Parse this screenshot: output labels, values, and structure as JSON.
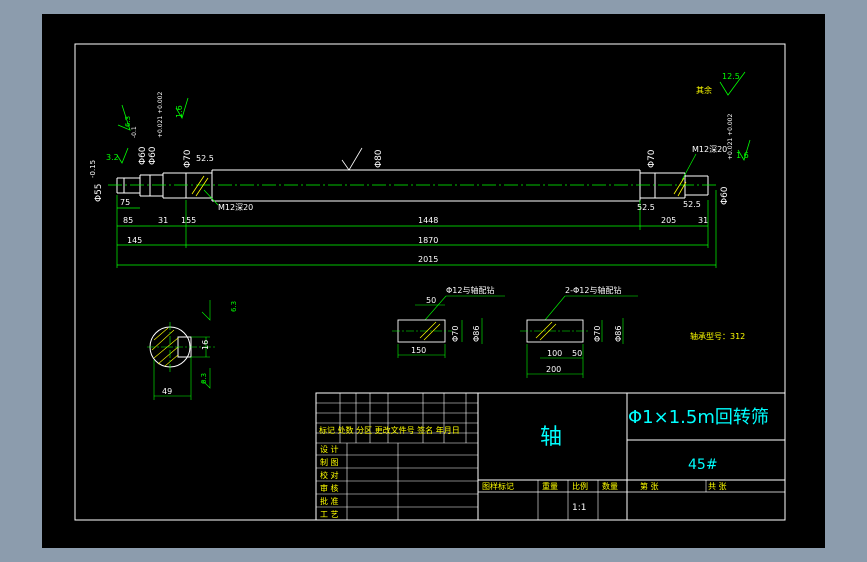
{
  "colors": {
    "outer_bg": "#8c9cad",
    "sheet_bg": "#000000",
    "line": "#ffffff",
    "dim": "#00ff00",
    "text": "#00ffff",
    "hatch": "#ffff00",
    "label": "#ffff00"
  },
  "roughness": {
    "general_label": "其余",
    "general_value": "12.5",
    "left_value": "1.6",
    "right_value": "1.6",
    "left_end_value": "3.2",
    "left_top_value": "6.3"
  },
  "shaft_dims": {
    "left_end_dia": "Φ55",
    "left_end_tol": "-0.15",
    "left_bearing_dia_1": "Φ60",
    "left_bearing_tol_1": "-0.1",
    "left_bearing_dia_2": "Φ60",
    "left_bearing_tol_2": "+0.021 +0.002",
    "left_shoulder_dia": "Φ70",
    "left_chamfer": "52.5",
    "body_dia": "Φ80",
    "right_shoulder_dia": "Φ70",
    "right_thread": "M12深20",
    "right_bearing_dia": "Φ60",
    "right_bearing_tol": "+0.021 +0.002",
    "left_thread": "M12深20",
    "l_75": "75",
    "l_85": "85",
    "l_31_left": "31",
    "l_155": "155",
    "l_1448": "1448",
    "l_525_right": "52.5",
    "l_525_right2": "52.5",
    "l_205": "205",
    "l_31_right": "31",
    "l_145": "145",
    "l_1870": "1870",
    "l_2015": "2015"
  },
  "keyway_left": {
    "title": "Φ12与轴配钻",
    "dim_50": "50",
    "dim_150": "150",
    "dia_70": "Φ70",
    "dia_86": "Φ86"
  },
  "keyway_right": {
    "title": "2-Φ12与轴配钻",
    "dim_100": "100",
    "dim_50": "50",
    "dim_200": "200",
    "dia_70": "Φ70",
    "dia_86": "Φ86"
  },
  "section": {
    "dim_16": "16",
    "dim_49": "49",
    "rough_top": "6.3",
    "rough_bottom": "6.3"
  },
  "bearing_note": "轴承型号：312",
  "title_block": {
    "part_name": "轴",
    "assembly_name": "Φ1×1.5m回转筛",
    "material": "45#",
    "rev_header": "标记 处数 分区 更改文件号 签名 年月日",
    "row_labels": [
      "设 计",
      "制 图",
      "校 对",
      "审 核",
      "批 准",
      "工 艺"
    ],
    "stage_mark": "图样标记",
    "weight": "重量",
    "scale_label": "比例",
    "qty": "数量",
    "scale_value": "1:1",
    "sheet_of": "第    张",
    "sheets_total": "共    张"
  }
}
